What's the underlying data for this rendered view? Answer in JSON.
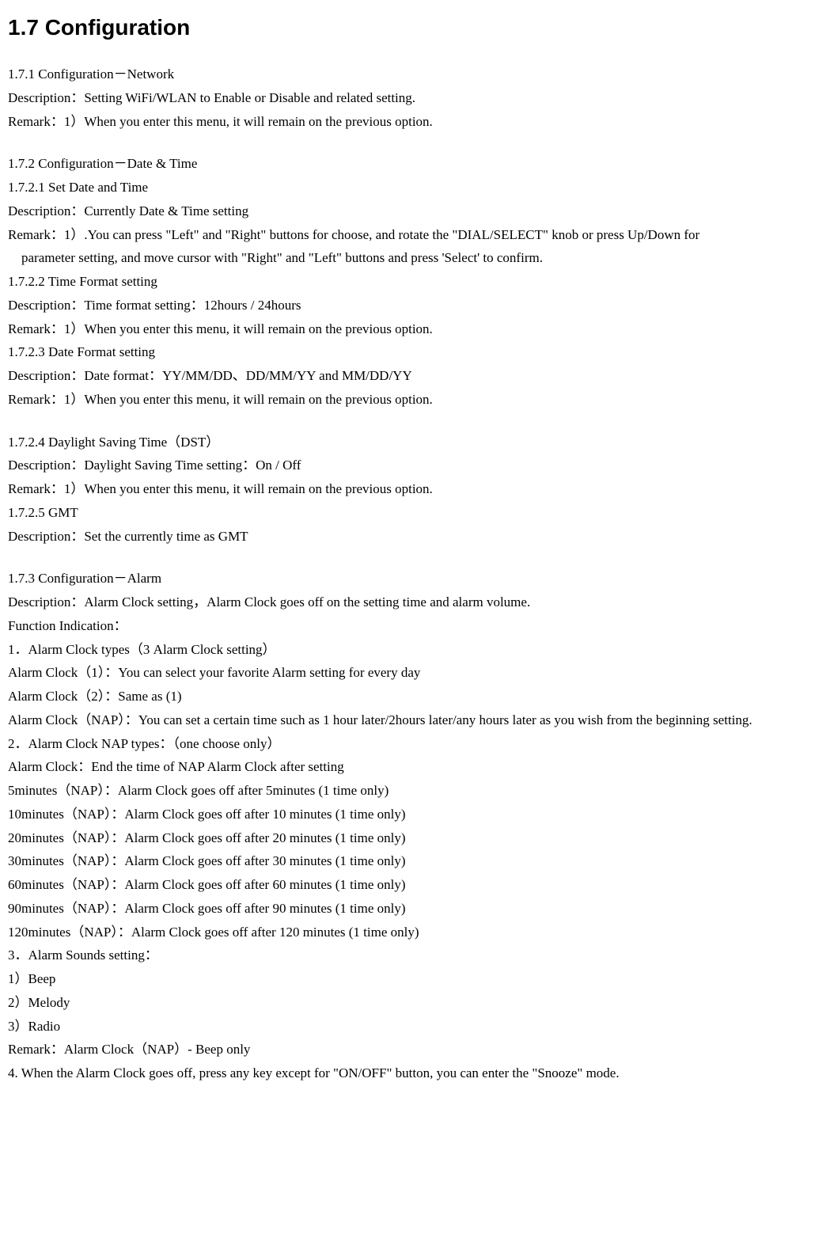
{
  "title": "1.7 Configuration",
  "s171": {
    "heading": "1.7.1 Configuration－Network",
    "desc": "Description：Setting WiFi/WLAN to Enable or Disable and related setting.",
    "remark": "Remark：1）When you enter this menu, it will remain on the previous option."
  },
  "s172": {
    "heading": "1.7.2 Configuration－Date & Time",
    "s1": {
      "heading": "1.7.2.1 Set Date and Time",
      "desc": "Description：Currently Date & Time setting",
      "remark1": "Remark：1）.You can press \"Left\" and \"Right\" buttons for choose, and rotate the \"DIAL/SELECT\" knob or press Up/Down for",
      "remark2": "parameter setting, and move cursor with \"Right\" and \"Left\" buttons and press 'Select' to confirm."
    },
    "s2": {
      "heading": "1.7.2.2 Time Format setting",
      "desc": "Description：Time format setting：12hours / 24hours",
      "remark": "Remark：1）When you enter this menu, it will remain on the previous option."
    },
    "s3": {
      "heading": "1.7.2.3 Date Format setting",
      "desc": "Description：Date format：YY/MM/DD、DD/MM/YY and MM/DD/YY",
      "remark": "Remark：1）When you enter this menu, it will remain on the previous option."
    },
    "s4": {
      "heading": "1.7.2.4 Daylight Saving Time（DST）",
      "desc": "Description：Daylight Saving Time setting：On / Off",
      "remark": "Remark：1）When you enter this menu, it will remain on the previous option."
    },
    "s5": {
      "heading": "1.7.2.5 GMT",
      "desc": "Description：Set the currently time as GMT"
    }
  },
  "s173": {
    "heading": "1.7.3 Configuration－Alarm",
    "desc": "Description：Alarm Clock setting，Alarm Clock goes off on the setting time and alarm volume.",
    "func": "Function Indication：",
    "types_heading": "1．Alarm Clock types（3 Alarm Clock setting）",
    "ac1": "Alarm Clock（1）：You can select your favorite Alarm setting for every day",
    "ac2": "Alarm Clock（2）：Same as (1)",
    "acnap": "Alarm Clock（NAP）：You can set a certain time such as 1 hour later/2hours later/any hours later as you wish from the beginning setting.",
    "nap_heading": "2．Alarm Clock NAP types：（one choose only）",
    "nap_end": "Alarm Clock：End the time of NAP Alarm Clock after setting",
    "nap5": "5minutes（NAP）：Alarm Clock goes off after 5minutes (1 time only)",
    "nap10": "10minutes（NAP）：Alarm Clock goes off after 10 minutes (1 time only)",
    "nap20": "20minutes（NAP）：Alarm Clock goes off after 20 minutes (1 time only)",
    "nap30": "30minutes（NAP）：Alarm Clock goes off after 30 minutes (1 time only)",
    "nap60": "60minutes（NAP）：Alarm Clock goes off after 60 minutes (1 time only)",
    "nap90": "90minutes（NAP）：Alarm Clock goes off after 90 minutes (1 time only)",
    "nap120": "120minutes（NAP）：Alarm Clock goes off after 120 minutes (1 time only)",
    "sounds_heading": "3．Alarm Sounds setting：",
    "sound1": "1）Beep",
    "sound2": "2）Melody",
    "sound3": "3）Radio",
    "remark": "Remark：Alarm Clock（NAP）- Beep only",
    "snooze": "4. When the Alarm Clock goes off, press any key except for \"ON/OFF\" button, you can enter the \"Snooze\" mode."
  }
}
